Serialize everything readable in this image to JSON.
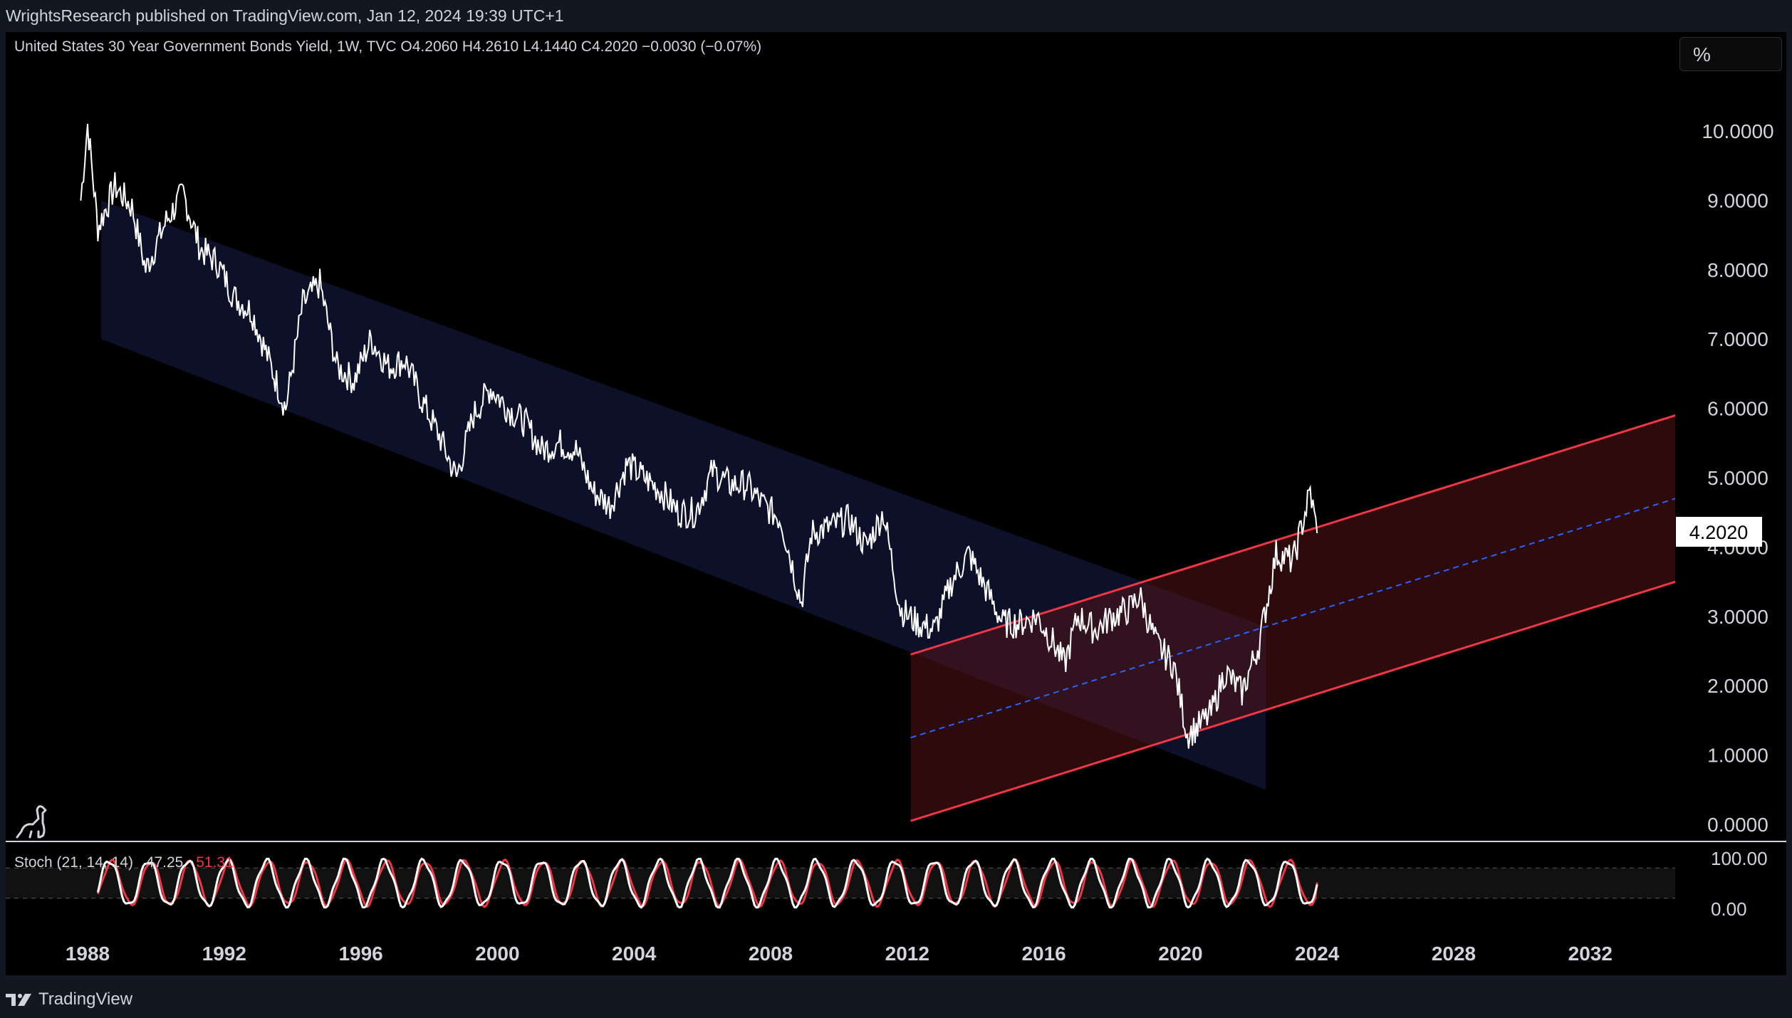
{
  "header": {
    "publish_line": "WrightsResearch published on TradingView.com, Jan 12, 2024 19:39 UTC+1"
  },
  "legend": {
    "symbol_line": "United States 30 Year Government Bonds Yield, 1W, TVC  O4.2060  H4.2610  L4.1440  C4.2020  −0.0030 (−0.07%)"
  },
  "scale_button": {
    "label": "%"
  },
  "current_price_label": "4.2020",
  "indicator": {
    "label": "Stoch (21, 14, 14)",
    "k_value": "47.25",
    "d_value": "51.31"
  },
  "footer": {
    "brand": "TradingView"
  },
  "colors": {
    "background": "#000000",
    "frame": "#131722",
    "price_line": "#ffffff",
    "up_channel": "#f23645",
    "down_channel_fill": "#0e1330",
    "median_line": "#2962ff",
    "stoch_k": "#ffffff",
    "stoch_d": "#f23645"
  },
  "chart_data": [
    {
      "type": "line",
      "title": "United States 30 Year Government Bonds Yield, 1W, TVC",
      "x_axis": {
        "ticks": [
          "1988",
          "1992",
          "1996",
          "2000",
          "2004",
          "2008",
          "2012",
          "2016",
          "2020",
          "2024",
          "2028",
          "2032"
        ],
        "range": [
          1988,
          2035.8
        ]
      },
      "y_axis": {
        "ticks": [
          "0.0000",
          "1.0000",
          "2.0000",
          "3.0000",
          "4.0000",
          "5.0000",
          "6.0000",
          "7.0000",
          "8.0000",
          "9.0000",
          "10.0000"
        ],
        "range": [
          0,
          10.8
        ],
        "side": "right",
        "unit": "%"
      },
      "grid": false,
      "series": [
        {
          "x": [
            1987.8,
            1988.0,
            1988.3,
            1988.8,
            1989.3,
            1989.7,
            1990.3,
            1990.8,
            1991.3,
            1991.8,
            1992.3,
            1992.8,
            1993.3,
            1993.8,
            1994.3,
            1994.8,
            1995.3,
            1995.8,
            1996.3,
            1996.8,
            1997.3,
            1997.8,
            1998.3,
            1998.8,
            1999.3,
            1999.8,
            2000.3,
            2000.8,
            2001.3,
            2001.8,
            2002.3,
            2002.8,
            2003.3,
            2003.8,
            2004.3,
            2004.8,
            2005.3,
            2005.8,
            2006.3,
            2006.8,
            2007.3,
            2007.8,
            2008.3,
            2008.9,
            2009.2,
            2009.8,
            2010.3,
            2010.8,
            2011.3,
            2011.8,
            2012.3,
            2012.8,
            2013.3,
            2013.8,
            2014.3,
            2014.8,
            2015.3,
            2015.8,
            2016.3,
            2016.6,
            2017.0,
            2017.5,
            2018.0,
            2018.5,
            2018.8,
            2019.3,
            2019.8,
            2020.2,
            2020.5,
            2020.9,
            2021.3,
            2021.8,
            2022.3,
            2022.8,
            2023.3,
            2023.8,
            2024.0
          ],
          "values": [
            9.0,
            10.1,
            8.6,
            9.2,
            8.9,
            8.0,
            8.7,
            9.1,
            8.3,
            8.1,
            7.6,
            7.4,
            6.7,
            6.0,
            7.5,
            7.8,
            6.6,
            6.4,
            7.0,
            6.6,
            6.7,
            6.1,
            5.6,
            5.0,
            5.9,
            6.3,
            6.0,
            5.8,
            5.4,
            5.5,
            5.4,
            4.8,
            4.6,
            5.2,
            5.0,
            4.8,
            4.5,
            4.5,
            5.1,
            4.9,
            4.9,
            4.6,
            4.4,
            3.2,
            4.2,
            4.3,
            4.4,
            4.0,
            4.5,
            3.1,
            2.9,
            2.8,
            3.5,
            3.9,
            3.4,
            2.9,
            2.9,
            3.0,
            2.6,
            2.3,
            3.0,
            2.8,
            3.0,
            3.1,
            3.3,
            2.6,
            2.3,
            1.3,
            1.4,
            1.6,
            2.2,
            1.9,
            2.6,
            3.9,
            3.8,
            4.8,
            4.2
          ]
        }
      ],
      "annotations": [
        {
          "name": "descending channel",
          "upper": [
            [
              1988.4,
              9.0
            ],
            [
              2022.5,
              2.85
            ]
          ],
          "lower": [
            [
              1988.4,
              7.0
            ],
            [
              2022.5,
              0.5
            ]
          ]
        },
        {
          "name": "ascending channel",
          "upper": [
            [
              2012.1,
              2.45
            ],
            [
              2035.8,
              6.1
            ]
          ],
          "median": [
            [
              2012.1,
              1.25
            ],
            [
              2035.8,
              4.9
            ]
          ],
          "lower": [
            [
              2012.1,
              0.05
            ],
            [
              2035.8,
              3.7
            ]
          ]
        }
      ]
    },
    {
      "type": "line",
      "title": "Stoch (21, 14, 14)",
      "y_axis": {
        "ticks": [
          "0.00",
          "100.00"
        ],
        "range": [
          0,
          100
        ],
        "bands": [
          80,
          20
        ]
      },
      "series": [
        {
          "name": "%K",
          "last_value": 47.25
        },
        {
          "name": "%D",
          "last_value": 51.31
        }
      ]
    }
  ]
}
